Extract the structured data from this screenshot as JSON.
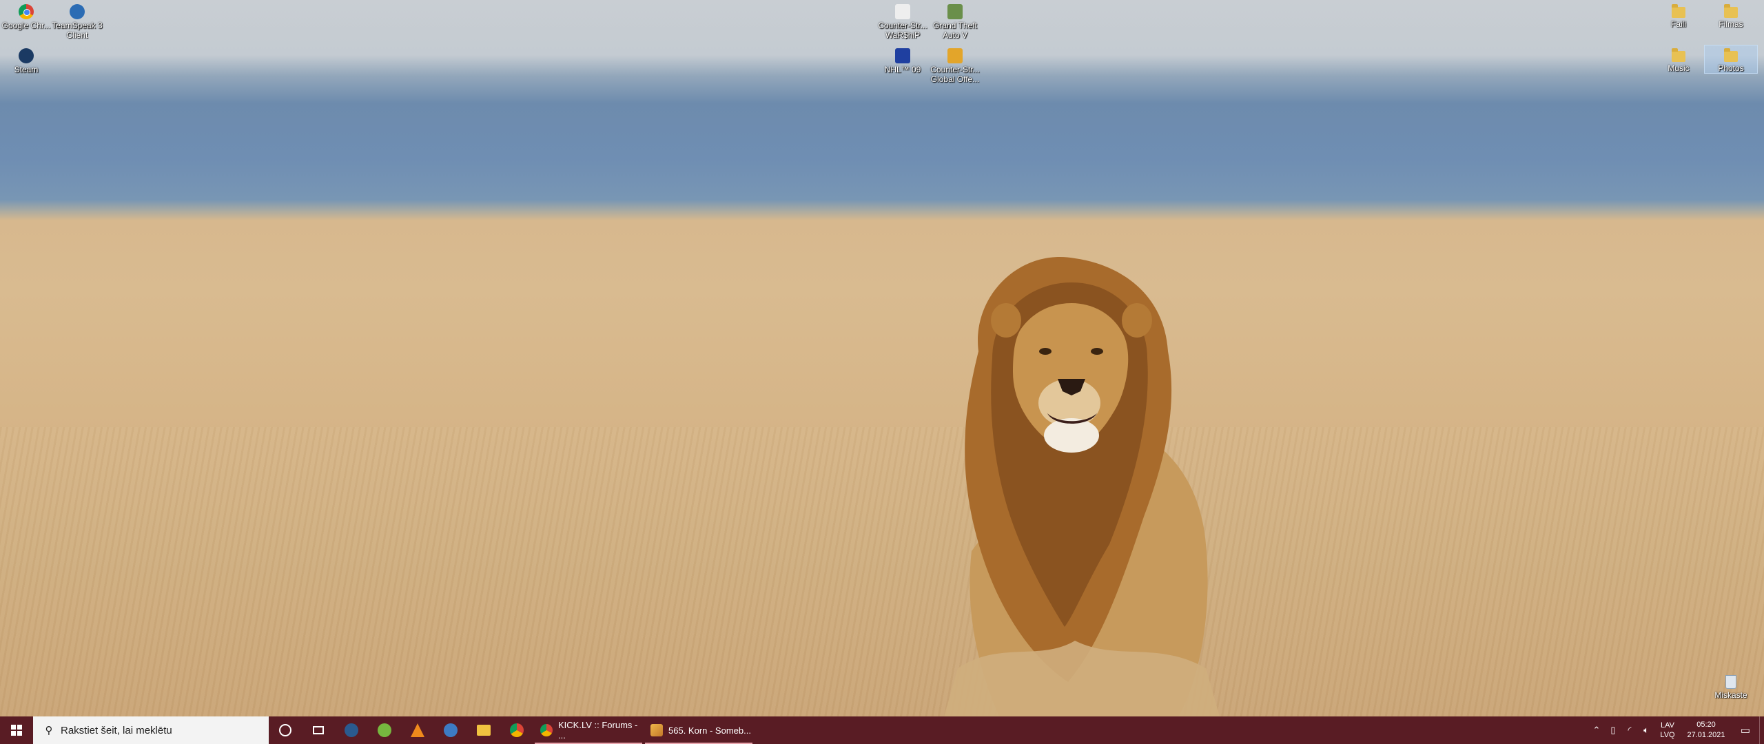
{
  "desktop": {
    "icons_left": [
      {
        "label": "Google Chr...",
        "icon": "chrome-icon",
        "color": "#e04b3c"
      },
      {
        "label": "TeamSpeak 3 Client",
        "icon": "teamspeak-icon",
        "color": "#2b6cb4"
      },
      {
        "label": "Steam",
        "icon": "steam-icon",
        "color": "#1b3a63"
      }
    ],
    "icons_center": [
      {
        "label": "Counter-Str... WaR$hiP",
        "icon": "counter-strike-icon"
      },
      {
        "label": "Grand Theft Auto V",
        "icon": "gta-v-icon"
      },
      {
        "label": "NHL™ 09",
        "icon": "nhl-09-icon"
      },
      {
        "label": "Counter-Str... Global Offe...",
        "icon": "csgo-icon"
      }
    ],
    "icons_right": [
      {
        "label": "Faili",
        "icon": "folder-icon"
      },
      {
        "label": "Filmas",
        "icon": "folder-icon"
      },
      {
        "label": "Music",
        "icon": "folder-icon"
      },
      {
        "label": "Photos",
        "icon": "folder-icon",
        "selected": true
      },
      {
        "label": "Miskaste",
        "icon": "recycle-bin-icon"
      }
    ]
  },
  "taskbar": {
    "color": "#591c24",
    "search_placeholder": "Rakstiet šeit, lai meklētu",
    "pinned": [
      "cortana-icon",
      "task-view-icon",
      "steam-icon",
      "utorrent-icon",
      "vlc-icon",
      "teamspeak-icon",
      "file-explorer-icon",
      "chrome-icon"
    ],
    "open_apps": [
      {
        "label": "KICK.LV :: Forums - ...",
        "icon": "chrome-icon"
      },
      {
        "label": "565. Korn - Someb...",
        "icon": "winamp-icon"
      }
    ],
    "tray": {
      "language_top": "LAV",
      "language_bottom": "LVQ",
      "time": "05:20",
      "date": "27.01.2021"
    }
  }
}
